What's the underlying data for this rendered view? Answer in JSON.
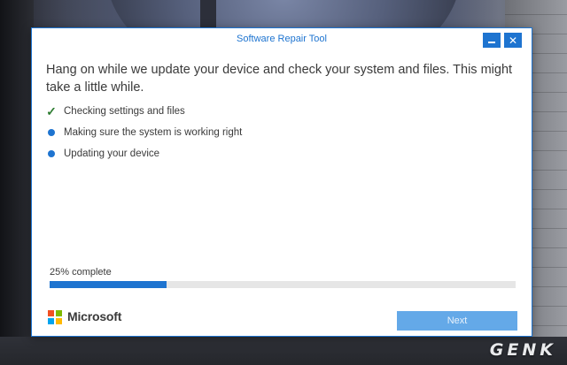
{
  "window": {
    "title": "Software Repair Tool"
  },
  "content": {
    "headline": "Hang on while we update your device and check your system and files. This might take a little while.",
    "steps": [
      {
        "label": "Checking settings and files",
        "status": "done",
        "icon": "checkmark-icon"
      },
      {
        "label": "Making sure the system is working right",
        "status": "pending",
        "icon": "bullet-icon"
      },
      {
        "label": "Updating your device",
        "status": "pending",
        "icon": "bullet-icon"
      }
    ]
  },
  "progress": {
    "label": "25% complete",
    "fraction": 0.25
  },
  "footer": {
    "brand": "Microsoft",
    "next_label": "Next"
  },
  "watermark": {
    "text": "GENK"
  },
  "colors": {
    "accent": "#1e74d0",
    "check": "#2e7d32",
    "next_disabled": "#64a9e8",
    "logo_red": "#f25022",
    "logo_green": "#7fba00",
    "logo_blue": "#00a4ef",
    "logo_yellow": "#ffb900"
  }
}
